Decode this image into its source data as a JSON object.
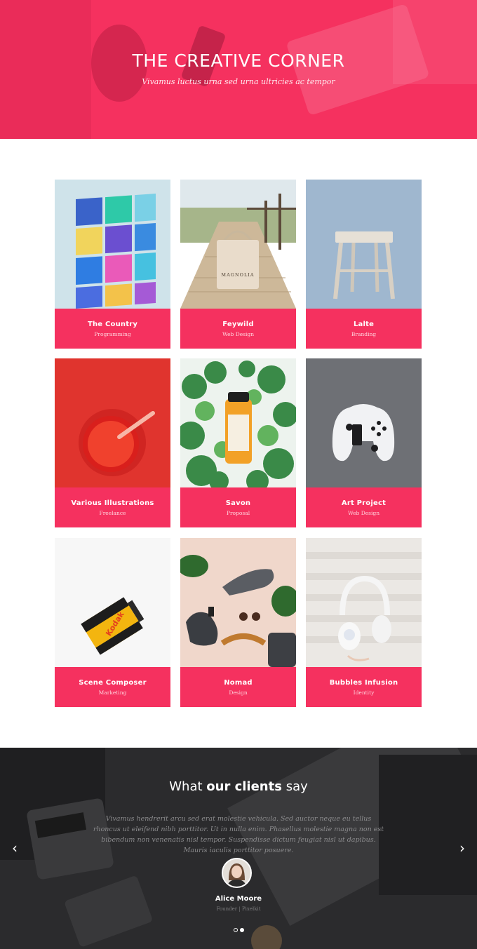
{
  "hero": {
    "title": "THE CREATIVE CORNER",
    "subtitle": "Vivamus luctus urna sed urna ultricies ac tempor"
  },
  "portfolio": {
    "items": [
      {
        "title": "The Country",
        "category": "Programming"
      },
      {
        "title": "Feywild",
        "category": "Web Design"
      },
      {
        "title": "Lalte",
        "category": "Branding"
      },
      {
        "title": "Various Illustrations",
        "category": "Freelance"
      },
      {
        "title": "Savon",
        "category": "Proposal"
      },
      {
        "title": "Art Project",
        "category": "Web Design"
      },
      {
        "title": "Scene Composer",
        "category": "Marketing"
      },
      {
        "title": "Nomad",
        "category": "Design"
      },
      {
        "title": "Bubbles Infusion",
        "category": "Identity"
      }
    ],
    "image_texts": {
      "tote_bag": "MAGNOLIA",
      "film_brand": "Kodak"
    }
  },
  "testimonials": {
    "heading_prefix": "What",
    "heading_bold": "our clients",
    "heading_suffix": "say",
    "quote": "Vivamus hendrerit arcu sed erat molestie vehicula. Sed auctor neque eu tellus rhoncus ut eleifend nibh porttitor. Ut in nulla enim. Phasellus molestie magna non est bibendum non venenatis nisl tempor. Suspendisse dictum feugiat nisl ut dapibus. Mauris iaculis porttitor posuere.",
    "client_name": "Alice Moore",
    "client_role": "Founder | Pixelkit",
    "prev_icon": "‹",
    "next_icon": "›",
    "active_slide": 2,
    "slide_count": 2
  },
  "colors": {
    "accent": "#f5315f",
    "dark_section": "#2c2c2e"
  }
}
